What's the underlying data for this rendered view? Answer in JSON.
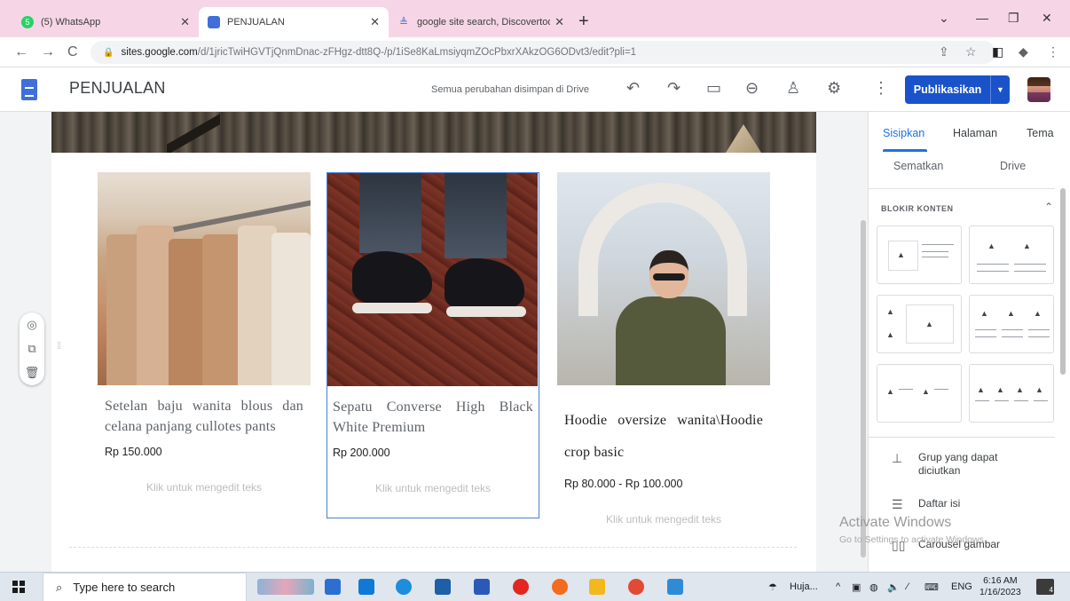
{
  "browser": {
    "tabs": [
      {
        "label": "(5) WhatsApp",
        "favicon_color": "#25d366",
        "favicon_text": "5"
      },
      {
        "label": "PENJUALAN",
        "favicon_color": "#3f6fd8",
        "favicon_text": ""
      },
      {
        "label": "google site search, Discovertoda",
        "favicon_color": "#4a7fd4",
        "favicon_text": ""
      }
    ],
    "url_host": "sites.google.com",
    "url_path": "/d/1jricTwiHGVTjQnmDnac-zFHgz-dtt8Q-/p/1iSe8KaLmsiyqmZOcPbxrXAkzOG6ODvt3/edit?pli=1"
  },
  "sites": {
    "title": "PENJUALAN",
    "saved_status": "Semua perubahan disimpan di Drive",
    "publish_label": "Publikasikan",
    "accent_color": "#1a53c9"
  },
  "products": [
    {
      "name": "Setelan baju wanita blous dan celana panjang cullotes pants",
      "price": "Rp 150.000",
      "hint": "Klik untuk mengedit teks"
    },
    {
      "name": "Sepatu Converse High Black White Premium",
      "price": "Rp 200.000",
      "hint": "Klik untuk mengedit teks"
    },
    {
      "name": "Hoodie oversize wanita\\Hoodie crop basic",
      "price": "Rp 80.000 - Rp 100.000",
      "hint": "Klik untuk mengedit teks"
    }
  ],
  "panel": {
    "tabs": [
      "Sisipkan",
      "Halaman",
      "Tema"
    ],
    "sub": [
      "Sematkan",
      "Drive"
    ],
    "section_title": "BLOKIR KONTEN",
    "items": [
      {
        "label": "Grup yang dapat diciutkan",
        "icon": "collapsible-group-icon"
      },
      {
        "label": "Daftar isi",
        "icon": "table-of-contents-icon"
      },
      {
        "label": "Carousel gambar",
        "icon": "image-carousel-icon"
      }
    ]
  },
  "watermark": {
    "title": "Activate Windows",
    "sub": "Go to Settings to activate Windows."
  },
  "taskbar": {
    "search_placeholder": "Type here to search",
    "weather": "Huja...",
    "lang": "ENG",
    "time": "6:16 AM",
    "date": "1/16/2023",
    "notifications": "4"
  }
}
